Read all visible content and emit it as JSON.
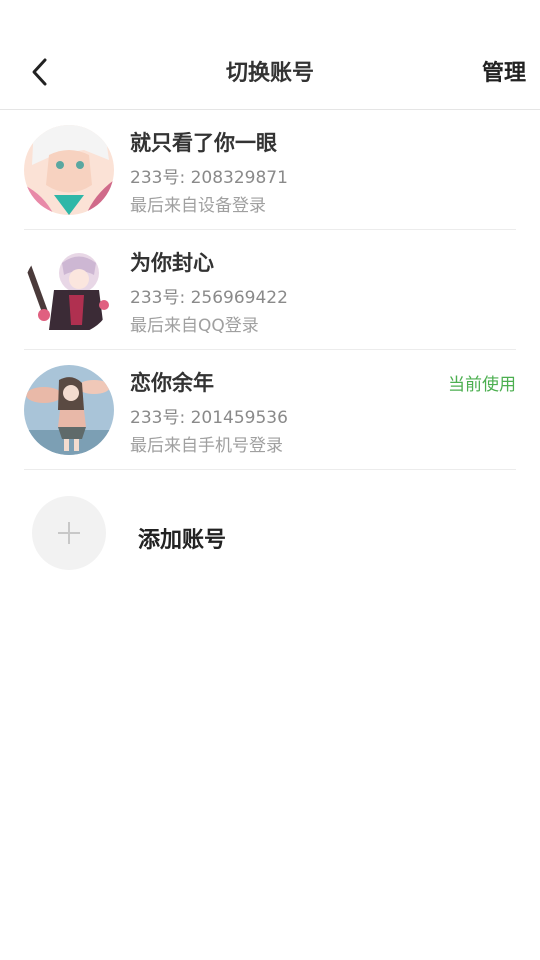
{
  "header": {
    "title": "切换账号",
    "manage_label": "管理"
  },
  "accounts": [
    {
      "name": "就只看了你一眼",
      "uid": "233号: 208329871",
      "login": "最后来自设备登录",
      "current": ""
    },
    {
      "name": "为你封心",
      "uid": "233号: 256969422",
      "login": "最后来自QQ登录",
      "current": ""
    },
    {
      "name": "恋你余年",
      "uid": "233号: 201459536",
      "login": "最后来自手机号登录",
      "current": "当前使用"
    }
  ],
  "add_account": {
    "label": "添加账号"
  },
  "colors": {
    "accent": "#4caf50",
    "divider": "#ececec"
  }
}
